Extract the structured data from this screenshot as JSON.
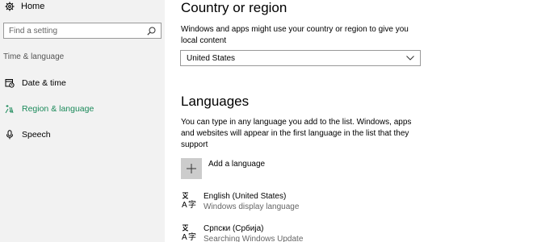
{
  "sidebar": {
    "home_label": "Home",
    "search_placeholder": "Find a setting",
    "section_label": "Time & language",
    "items": [
      {
        "label": "Date & time",
        "icon": "calendar-icon",
        "active": false
      },
      {
        "label": "Region & language",
        "icon": "globe-person-icon",
        "active": true
      },
      {
        "label": "Speech",
        "icon": "microphone-icon",
        "active": false
      }
    ]
  },
  "main": {
    "country_heading": "Country or region",
    "country_description": "Windows and apps might use your country or region to give you local content",
    "country_value": "United States",
    "languages_heading": "Languages",
    "languages_description": "You can type in any language you add to the list. Windows, apps and websites will appear in the first language in the list that they support",
    "add_language_label": "Add a language",
    "languages": [
      {
        "name": "English (United States)",
        "status": "Windows display language"
      },
      {
        "name": "Српски (Србија)",
        "status": "Searching Windows Update"
      }
    ]
  },
  "colors": {
    "accent": "#1b8a5a",
    "sidebar_bg": "#f2f2f2",
    "add_button_bg": "#cccccc"
  }
}
